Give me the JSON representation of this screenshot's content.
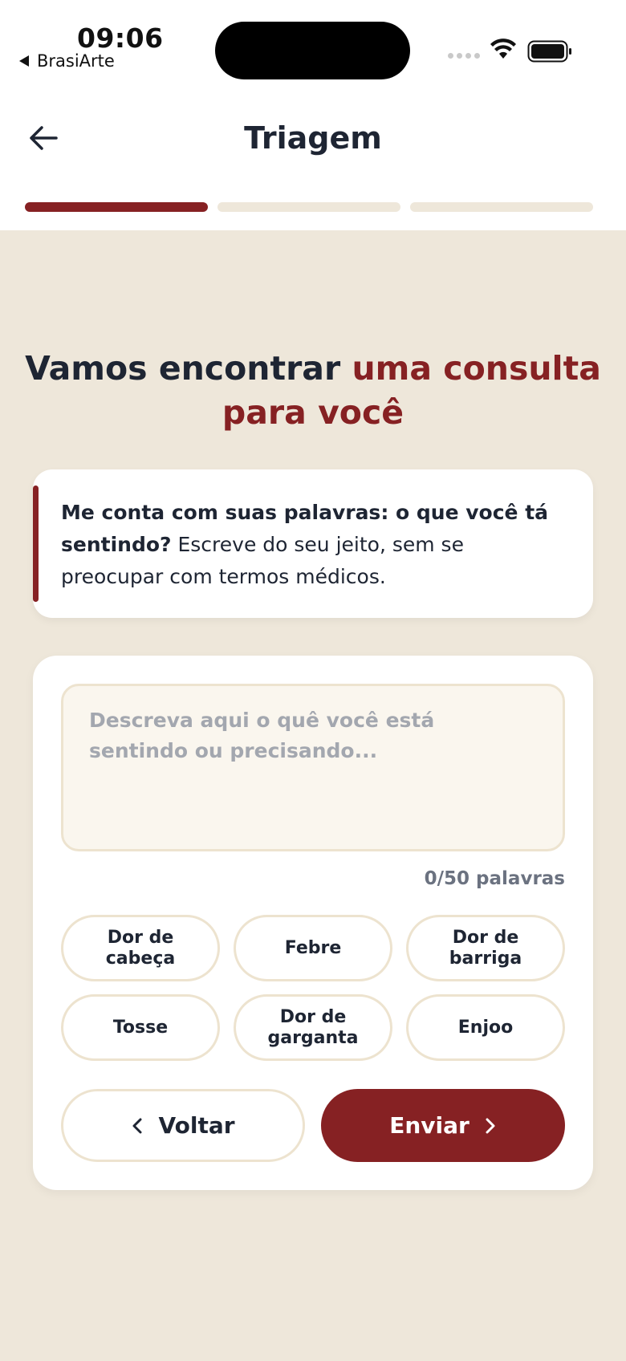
{
  "status": {
    "time": "09:06",
    "back_app": "BrasiArte"
  },
  "header": {
    "title": "Triagem",
    "progress_steps": [
      {
        "active": true
      },
      {
        "active": false
      },
      {
        "active": false
      }
    ]
  },
  "headline": {
    "part1": "Vamos encontrar ",
    "part2_accent": "uma consulta para você"
  },
  "prompt": {
    "bold": "Me conta com suas palavras: o que você tá sentindo?",
    "rest": " Escreve do seu jeito, sem se preocupar com termos médicos."
  },
  "form": {
    "textarea_placeholder": "Descreva aqui o quê você está sentindo ou precisando...",
    "textarea_value": "",
    "counter": "0/50 palavras",
    "chips": [
      "Dor de cabeça",
      "Febre",
      "Dor de barriga",
      "Tosse",
      "Dor de garganta",
      "Enjoo"
    ],
    "back_label": "Voltar",
    "send_label": "Enviar"
  },
  "colors": {
    "accent": "#862123",
    "background": "#EEE7DA",
    "text": "#1E2533"
  }
}
